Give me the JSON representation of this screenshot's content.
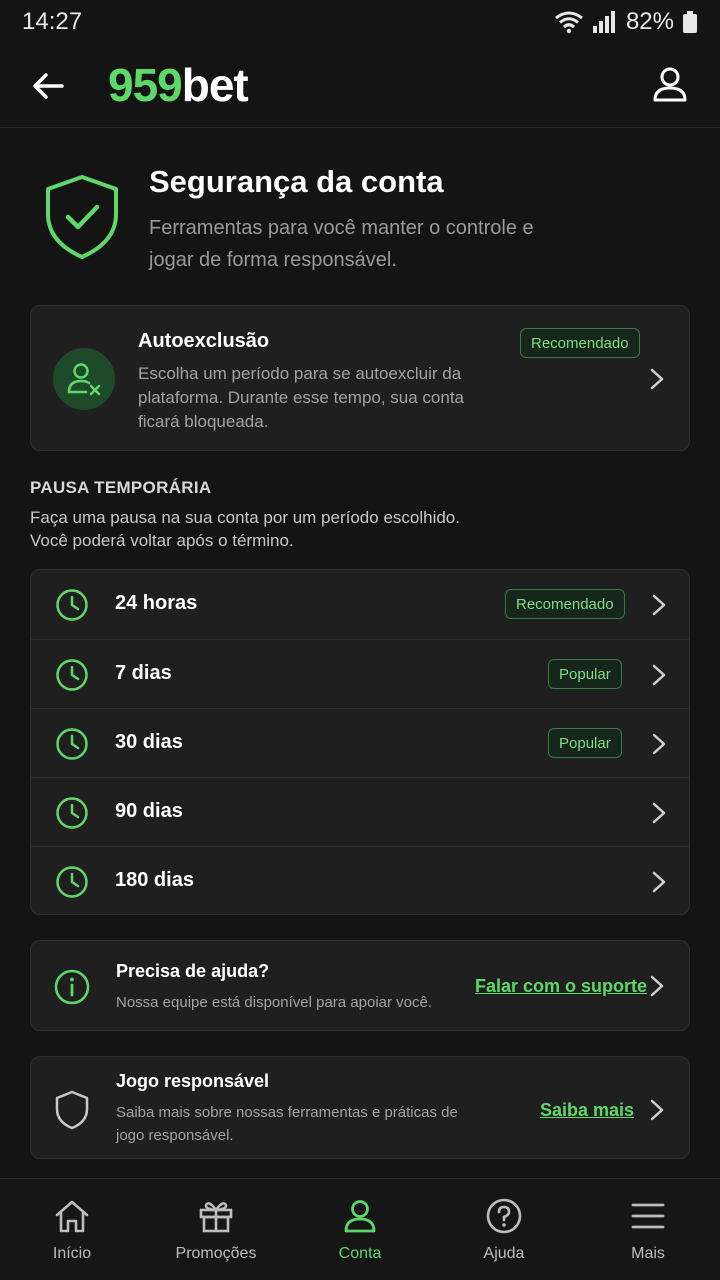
{
  "status_bar": {
    "time": "14:27",
    "battery": "82%"
  },
  "header": {
    "logo_number": "959",
    "logo_word": "bet"
  },
  "hero": {
    "title": "Segurança da conta",
    "subtitle": "Ferramentas para você manter o controle e jogar de forma responsável."
  },
  "autoexclusion": {
    "title": "Autoexclusão",
    "badge": "Recomendado",
    "description": "Escolha um período para se autoexcluir da plataforma. Durante esse tempo, sua conta ficará bloqueada."
  },
  "pause_section": {
    "title": "PAUSA TEMPORÁRIA",
    "description_line1": "Faça uma pausa na sua conta por um período escolhido.",
    "description_line2": "Você poderá voltar após o término."
  },
  "pause_options": [
    {
      "label": "24 horas",
      "badge": "Recomendado"
    },
    {
      "label": "7 dias",
      "badge": "Popular"
    },
    {
      "label": "30 dias",
      "badge": "Popular"
    },
    {
      "label": "90 dias",
      "badge": ""
    },
    {
      "label": "180 dias",
      "badge": ""
    }
  ],
  "help_card": {
    "title": "Precisa de ajuda?",
    "description": "Nossa equipe está disponível para apoiar você.",
    "link": "Falar com o suporte"
  },
  "responsible_card": {
    "title": "Jogo responsável",
    "description": "Saiba mais sobre nossas ferramentas e práticas de jogo responsável.",
    "link": "Saiba mais"
  },
  "bottom_nav": {
    "items": [
      {
        "label": "Início",
        "icon": "home-icon"
      },
      {
        "label": "Promoções",
        "icon": "gift-icon"
      },
      {
        "label": "Conta",
        "icon": "user-icon",
        "active": true
      },
      {
        "label": "Ajuda",
        "icon": "help-icon"
      },
      {
        "label": "Mais",
        "icon": "menu-icon"
      }
    ]
  },
  "colors": {
    "accent": "#5fd86a",
    "background": "#141414",
    "card": "#1f1f1f"
  }
}
